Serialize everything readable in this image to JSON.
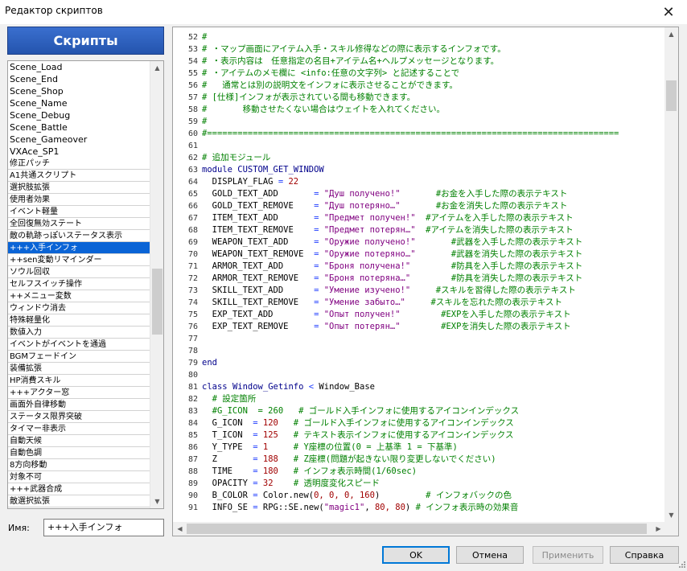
{
  "window": {
    "title": "Редактор скриптов",
    "close_glyph": "✕"
  },
  "left": {
    "header": "Скрипты",
    "items": [
      "Scene_Load",
      "Scene_End",
      "Scene_Shop",
      "Scene_Name",
      "Scene_Debug",
      "Scene_Battle",
      "Scene_Gameover",
      "VXAce_SP1",
      "修正パッチ",
      "A1共通スクリプト",
      "選択肢拡張",
      "使用者効果",
      "イベント軽量",
      "全回復無効ステート",
      "敵の軌跡っぽいステータス表示",
      "+++入手インフォ",
      "++sen変動リマインダー",
      "ソウル回収",
      "セルフスイッチ操作",
      "++メニュー変数",
      "ウィンドウ消去",
      "特殊軽量化",
      "数値入力",
      "イベントがイベントを通過",
      "BGMフェードイン",
      "装備拡張",
      "HP消費スキル",
      "+++アクター窓",
      "画面外自律移動",
      "ステータス限界突破",
      "タイマー非表示",
      "自動天候",
      "自動色調",
      "8方向移動",
      "対象不可",
      "+++武器合成",
      "敵選択拡張"
    ],
    "selected_index": 15,
    "scene_count": 8,
    "name_label": "Имя:",
    "name_value": "+++入手インフォ"
  },
  "editor": {
    "lines": [
      {
        "n": "52",
        "t": [
          [
            "#",
            "c-comment"
          ]
        ]
      },
      {
        "n": "53",
        "t": [
          [
            "# ・マップ画面にアイテム入手・スキル修得などの際に表示するインフォです。",
            "c-comment"
          ]
        ]
      },
      {
        "n": "54",
        "t": [
          [
            "# ・表示内容は　任意指定の名目+アイテム名+ヘルプメッセージとなります。",
            "c-comment"
          ]
        ]
      },
      {
        "n": "55",
        "t": [
          [
            "# ・アイテムのメモ欄に <info:任意の文字列> と記述することで",
            "c-comment"
          ]
        ]
      },
      {
        "n": "56",
        "t": [
          [
            "#   通常とは別の説明文をインフォに表示させることができます。",
            "c-comment"
          ]
        ]
      },
      {
        "n": "57",
        "t": [
          [
            "# [仕様]インフォが表示されている間も移動できます。",
            "c-comment"
          ]
        ]
      },
      {
        "n": "58",
        "t": [
          [
            "#       移動させたくない場合はウェイトを入れてください。",
            "c-comment"
          ]
        ]
      },
      {
        "n": "59",
        "t": [
          [
            "#",
            "c-comment"
          ]
        ]
      },
      {
        "n": "60",
        "t": [
          [
            "#=================================================================================",
            "c-comment"
          ]
        ]
      },
      {
        "n": "61",
        "t": []
      },
      {
        "n": "62",
        "t": [
          [
            "# 追加モジュール",
            "c-comment"
          ]
        ]
      },
      {
        "n": "63",
        "t": [
          [
            "module ",
            "c-keyword"
          ],
          [
            "CUSTOM_GET_WINDOW",
            "c-keyword"
          ]
        ]
      },
      {
        "n": "64",
        "t": [
          [
            "  DISPLAY_FLAG ",
            "c-normal"
          ],
          [
            "= ",
            "c-op"
          ],
          [
            "22",
            "c-number"
          ]
        ]
      },
      {
        "n": "65",
        "t": [
          [
            "  GOLD_TEXT_ADD       ",
            "c-normal"
          ],
          [
            "= ",
            "c-op"
          ],
          [
            "\"Душ получено!\"",
            "c-string"
          ],
          [
            "       #お金を入手した際の表示テキスト",
            "c-comment"
          ]
        ]
      },
      {
        "n": "66",
        "t": [
          [
            "  GOLD_TEXT_REMOVE    ",
            "c-normal"
          ],
          [
            "= ",
            "c-op"
          ],
          [
            "\"Душ потеряно…\"",
            "c-string"
          ],
          [
            "       #お金を消失した際の表示テキスト",
            "c-comment"
          ]
        ]
      },
      {
        "n": "67",
        "t": [
          [
            "  ITEM_TEXT_ADD       ",
            "c-normal"
          ],
          [
            "= ",
            "c-op"
          ],
          [
            "\"Предмет получен!\"",
            "c-string"
          ],
          [
            "  #アイテムを入手した際の表示テキスト",
            "c-comment"
          ]
        ]
      },
      {
        "n": "68",
        "t": [
          [
            "  ITEM_TEXT_REMOVE    ",
            "c-normal"
          ],
          [
            "= ",
            "c-op"
          ],
          [
            "\"Предмет потерян…\"",
            "c-string"
          ],
          [
            "  #アイテムを消失した際の表示テキスト",
            "c-comment"
          ]
        ]
      },
      {
        "n": "69",
        "t": [
          [
            "  WEAPON_TEXT_ADD     ",
            "c-normal"
          ],
          [
            "= ",
            "c-op"
          ],
          [
            "\"Оружие получено!\"",
            "c-string"
          ],
          [
            "       #武器を入手した際の表示テキスト",
            "c-comment"
          ]
        ]
      },
      {
        "n": "70",
        "t": [
          [
            "  WEAPON_TEXT_REMOVE  ",
            "c-normal"
          ],
          [
            "= ",
            "c-op"
          ],
          [
            "\"Оружие потеряно…\"",
            "c-string"
          ],
          [
            "       #武器を消失した際の表示テキスト",
            "c-comment"
          ]
        ]
      },
      {
        "n": "71",
        "t": [
          [
            "  ARMOR_TEXT_ADD      ",
            "c-normal"
          ],
          [
            "= ",
            "c-op"
          ],
          [
            "\"Броня получена!\"",
            "c-string"
          ],
          [
            "        #防具を入手した際の表示テキスト",
            "c-comment"
          ]
        ]
      },
      {
        "n": "72",
        "t": [
          [
            "  ARMOR_TEXT_REMOVE   ",
            "c-normal"
          ],
          [
            "= ",
            "c-op"
          ],
          [
            "\"Броня потеряна…\"",
            "c-string"
          ],
          [
            "        #防具を消失した際の表示テキスト",
            "c-comment"
          ]
        ]
      },
      {
        "n": "73",
        "t": [
          [
            "  SKILL_TEXT_ADD      ",
            "c-normal"
          ],
          [
            "= ",
            "c-op"
          ],
          [
            "\"Умение изучено!\"",
            "c-string"
          ],
          [
            "     #スキルを習得した際の表示テキスト",
            "c-comment"
          ]
        ]
      },
      {
        "n": "74",
        "t": [
          [
            "  SKILL_TEXT_REMOVE   ",
            "c-normal"
          ],
          [
            "= ",
            "c-op"
          ],
          [
            "\"Умение забыто…\"",
            "c-string"
          ],
          [
            "     #スキルを忘れた際の表示テキスト",
            "c-comment"
          ]
        ]
      },
      {
        "n": "75",
        "t": [
          [
            "  EXP_TEXT_ADD        ",
            "c-normal"
          ],
          [
            "= ",
            "c-op"
          ],
          [
            "\"Опыт получен!\"",
            "c-string"
          ],
          [
            "        #EXPを入手した際の表示テキスト",
            "c-comment"
          ]
        ]
      },
      {
        "n": "76",
        "t": [
          [
            "  EXP_TEXT_REMOVE     ",
            "c-normal"
          ],
          [
            "= ",
            "c-op"
          ],
          [
            "\"Опыт потерян…\"",
            "c-string"
          ],
          [
            "        #EXPを消失した際の表示テキスト",
            "c-comment"
          ]
        ]
      },
      {
        "n": "77",
        "t": []
      },
      {
        "n": "78",
        "t": []
      },
      {
        "n": "79",
        "t": [
          [
            "end",
            "c-keyword"
          ]
        ]
      },
      {
        "n": "80",
        "t": []
      },
      {
        "n": "81",
        "t": [
          [
            "class ",
            "c-keyword"
          ],
          [
            "Window_Getinfo ",
            "c-keyword"
          ],
          [
            "< ",
            "c-op"
          ],
          [
            "Window_Base",
            "c-normal"
          ]
        ]
      },
      {
        "n": "82",
        "t": [
          [
            "  # 設定箇所",
            "c-comment"
          ]
        ]
      },
      {
        "n": "83",
        "t": [
          [
            "  #G_ICON  = 260   # ゴールド入手インフォに使用するアイコンインデックス",
            "c-comment"
          ]
        ]
      },
      {
        "n": "84",
        "t": [
          [
            "  G_ICON  ",
            "c-normal"
          ],
          [
            "= ",
            "c-op"
          ],
          [
            "120",
            "c-number"
          ],
          [
            "   # ゴールド入手インフォに使用するアイコンインデックス",
            "c-comment"
          ]
        ]
      },
      {
        "n": "85",
        "t": [
          [
            "  T_ICON  ",
            "c-normal"
          ],
          [
            "= ",
            "c-op"
          ],
          [
            "125",
            "c-number"
          ],
          [
            "   # テキスト表示インフォに使用するアイコンインデックス",
            "c-comment"
          ]
        ]
      },
      {
        "n": "86",
        "t": [
          [
            "  Y_TYPE  ",
            "c-normal"
          ],
          [
            "= ",
            "c-op"
          ],
          [
            "1",
            "c-number"
          ],
          [
            "     # Y座標の位置(0 = 上基準 1 = 下基準)",
            "c-comment"
          ]
        ]
      },
      {
        "n": "87",
        "t": [
          [
            "  Z       ",
            "c-normal"
          ],
          [
            "= ",
            "c-op"
          ],
          [
            "188",
            "c-number"
          ],
          [
            "   # Z座標(問題が起きない限り変更しないでください)",
            "c-comment"
          ]
        ]
      },
      {
        "n": "88",
        "t": [
          [
            "  TIME    ",
            "c-normal"
          ],
          [
            "= ",
            "c-op"
          ],
          [
            "180",
            "c-number"
          ],
          [
            "   # インフォ表示時間(1/60sec)",
            "c-comment"
          ]
        ]
      },
      {
        "n": "89",
        "t": [
          [
            "  OPACITY ",
            "c-normal"
          ],
          [
            "= ",
            "c-op"
          ],
          [
            "32",
            "c-number"
          ],
          [
            "    # 透明度変化スピード",
            "c-comment"
          ]
        ]
      },
      {
        "n": "90",
        "t": [
          [
            "  B_COLOR ",
            "c-normal"
          ],
          [
            "= ",
            "c-op"
          ],
          [
            "Color.new(",
            "c-normal"
          ],
          [
            "0, 0, 0, 160",
            "c-number"
          ],
          [
            ")",
            "c-normal"
          ],
          [
            "         # インフォバックの色",
            "c-comment"
          ]
        ]
      },
      {
        "n": "91",
        "t": [
          [
            "  INFO_SE ",
            "c-normal"
          ],
          [
            "= ",
            "c-op"
          ],
          [
            "RPG::SE.new(",
            "c-normal"
          ],
          [
            "\"magic1\"",
            "c-string"
          ],
          [
            ", ",
            "c-normal"
          ],
          [
            "80, 80",
            "c-number"
          ],
          [
            ") ",
            "c-normal"
          ],
          [
            "# インフォ表示時の効果音",
            "c-comment"
          ]
        ]
      }
    ]
  },
  "buttons": {
    "ok": "OK",
    "cancel": "Отмена",
    "apply": "Применить",
    "help": "Справка"
  }
}
